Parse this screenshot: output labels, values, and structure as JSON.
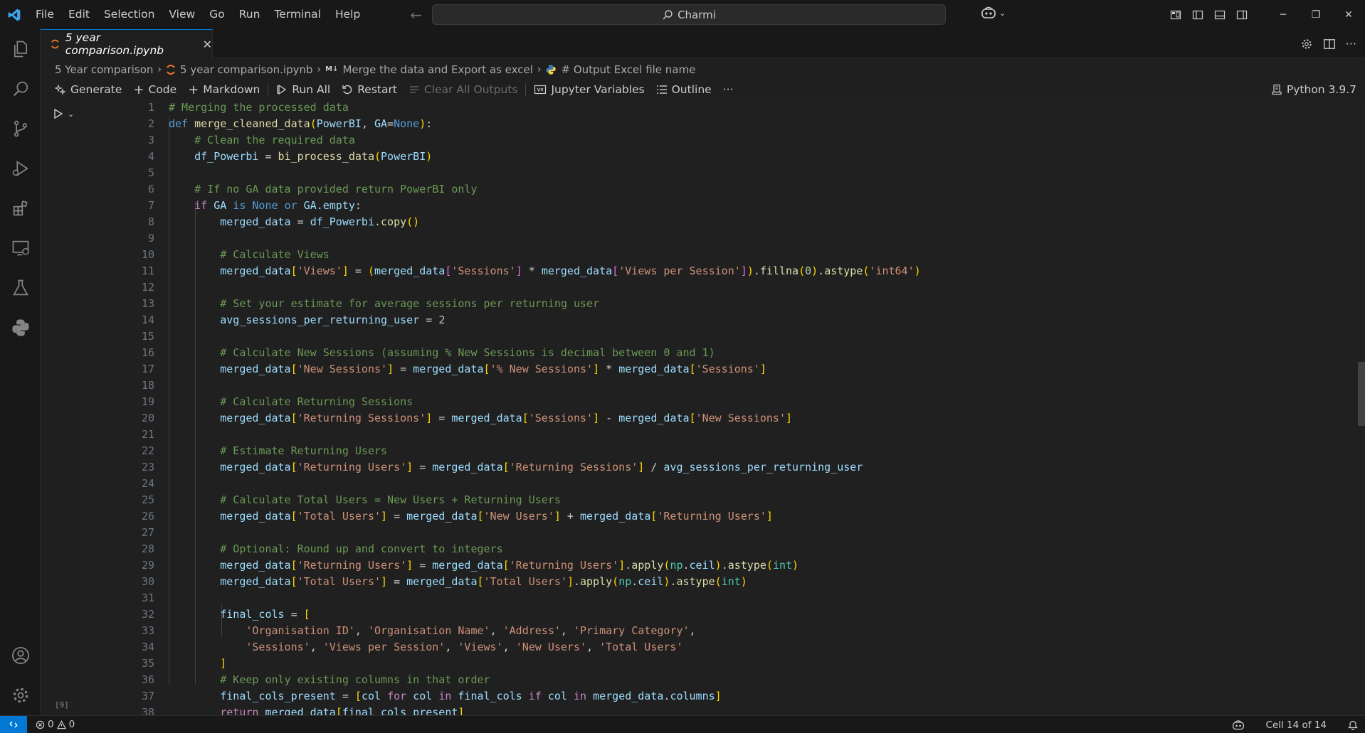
{
  "menu": [
    "File",
    "Edit",
    "Selection",
    "View",
    "Go",
    "Run",
    "Terminal",
    "Help"
  ],
  "search": {
    "label": "Charmi"
  },
  "tab": {
    "label": "5 year comparison.ipynb"
  },
  "breadcrumb": {
    "folder": "5 Year comparison",
    "file": "5 year comparison.ipynb",
    "md_badge": "M↓",
    "section": "Merge the data and Export as excel",
    "symbol": "# Output Excel file name"
  },
  "toolbar": {
    "generate": "Generate",
    "code": "Code",
    "markdown": "Markdown",
    "run_all": "Run All",
    "restart": "Restart",
    "clear_outputs": "Clear All Outputs",
    "variables": "Jupyter Variables",
    "outline": "Outline",
    "more": "···",
    "kernel": "Python 3.9.7"
  },
  "cell": {
    "exec_count": "[9]"
  },
  "status": {
    "errors": "0",
    "warnings": "0",
    "cell_position": "Cell 14 of 14"
  },
  "colors": {
    "accent": "#0078d4",
    "background": "#1f1f1f",
    "comment": "#6a9955",
    "string": "#ce9178",
    "keyword": "#569cd6"
  },
  "code_lines": [
    "1",
    "2",
    "3",
    "4",
    "5",
    "6",
    "7",
    "8",
    "9",
    "10",
    "11",
    "12",
    "13",
    "14",
    "15",
    "16",
    "17",
    "18",
    "19",
    "20",
    "21",
    "22",
    "23",
    "24",
    "25",
    "26",
    "27",
    "28",
    "29",
    "30",
    "31",
    "32",
    "33",
    "34",
    "35",
    "36",
    "37",
    "38"
  ]
}
